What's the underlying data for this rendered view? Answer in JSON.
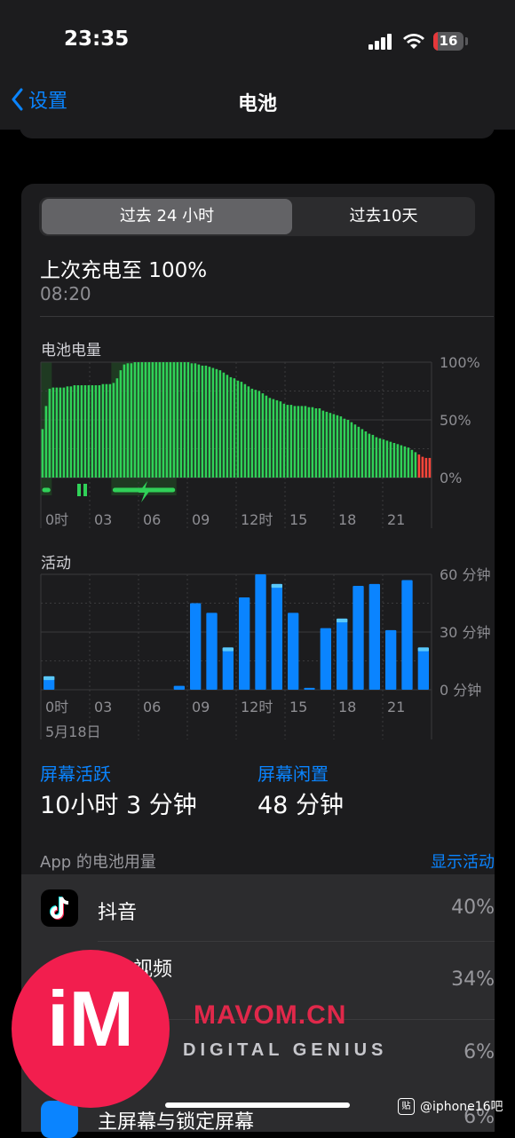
{
  "status_bar": {
    "time": "23:35",
    "battery_level": "16",
    "battery_fraction": 0.16
  },
  "nav": {
    "back_label": "设置",
    "title": "电池"
  },
  "segment": {
    "options": [
      "过去 24 小时",
      "过去10天"
    ],
    "selected": 0
  },
  "last_charge": {
    "title": "上次充电至 100%",
    "time": "08:20"
  },
  "battery_chart": {
    "label": "电池电量",
    "y_ticks": [
      "100%",
      "50%",
      "0%"
    ],
    "x_ticks": [
      "0时",
      "03",
      "06",
      "09",
      "12时",
      "15",
      "18",
      "21"
    ]
  },
  "activity_chart": {
    "label": "活动",
    "y_ticks": [
      "60 分钟",
      "30 分钟",
      "0 分钟"
    ],
    "x_ticks": [
      "0时",
      "03",
      "06",
      "09",
      "12时",
      "15",
      "18",
      "21"
    ],
    "date": "5月18日"
  },
  "chart_data": [
    {
      "type": "bar",
      "name": "battery_level",
      "x_unit": "hour",
      "ylim": [
        0,
        100
      ],
      "charging_hours": [
        [
          0,
          0.67
        ],
        [
          4.33,
          8.33
        ]
      ],
      "values": [
        42,
        62,
        77,
        78,
        78,
        78,
        78,
        79,
        79,
        80,
        80,
        80,
        80,
        80,
        80,
        80,
        80,
        81,
        81,
        81,
        82,
        86,
        93,
        98,
        99,
        99,
        100,
        100,
        100,
        100,
        100,
        100,
        100,
        100,
        100,
        100,
        100,
        100,
        100,
        100,
        100,
        100,
        99,
        99,
        98,
        97,
        97,
        96,
        95,
        94,
        93,
        91,
        89,
        87,
        86,
        84,
        83,
        81,
        79,
        77,
        76,
        75,
        73,
        71,
        69,
        68,
        67,
        66,
        64,
        63,
        63,
        62,
        62,
        62,
        62,
        61,
        61,
        60,
        60,
        58,
        57,
        56,
        55,
        54,
        53,
        51,
        50,
        48,
        46,
        44,
        42,
        40,
        38,
        37,
        35,
        34,
        33,
        32,
        31,
        30,
        29,
        28,
        27,
        26,
        24,
        22,
        20,
        18,
        17,
        17
      ]
    },
    {
      "type": "bar",
      "name": "screen_activity",
      "x_unit": "hour",
      "ylim": [
        0,
        60
      ],
      "categories": [
        "0",
        "1",
        "2",
        "3",
        "4",
        "5",
        "6",
        "7",
        "8",
        "9",
        "10",
        "11",
        "12",
        "13",
        "14",
        "15",
        "16",
        "17",
        "18",
        "19",
        "20",
        "21",
        "22",
        "23"
      ],
      "values": [
        7,
        0,
        0,
        0,
        0,
        0,
        0,
        0,
        2,
        45,
        40,
        22,
        48,
        60,
        55,
        40,
        1,
        32,
        37,
        54,
        55,
        31,
        57,
        22
      ],
      "highlight_minutes": [
        2,
        0,
        0,
        0,
        0,
        0,
        0,
        0,
        0,
        0,
        0,
        2,
        0,
        0,
        2,
        0,
        0,
        0,
        2,
        0,
        0,
        0,
        0,
        2
      ]
    }
  ],
  "screen_stats": {
    "active_label": "屏幕活跃",
    "active_value": "10小时 3 分钟",
    "idle_label": "屏幕闲置",
    "idle_value": "48 分钟"
  },
  "app_usage": {
    "header": "App 的电池用量",
    "show_activity": "显示活动",
    "apps": [
      {
        "name": "抖音",
        "percent": "40%"
      },
      {
        "name": "视频",
        "percent": "34%"
      },
      {
        "name": "",
        "percent": "6%"
      },
      {
        "name": "主屏幕与锁定屏幕",
        "percent": "6%"
      }
    ]
  },
  "watermark": {
    "logo_text": "iM",
    "brand": "MAVOM.CN",
    "tagline": "DIGITAL GENIUS",
    "forum_tag": "@iphone16吧",
    "forum_icon": "贴"
  },
  "colors": {
    "accent": "#0a84ff",
    "battery_green": "#30d158",
    "battery_low": "#ff453a",
    "activity_blue": "#0a84ff",
    "activity_light": "#5ac8fa",
    "logo_red": "#f21e4e"
  }
}
